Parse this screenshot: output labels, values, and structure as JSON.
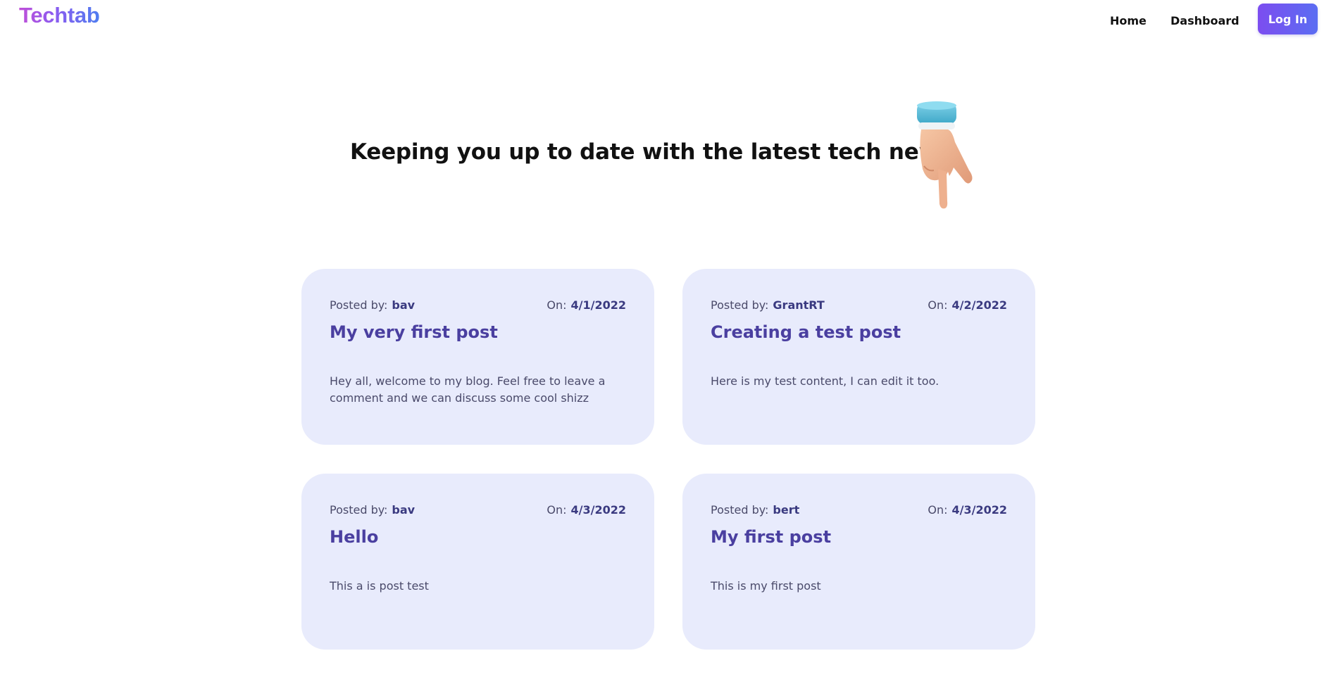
{
  "header": {
    "logo": "Techtab",
    "nav": {
      "home": "Home",
      "dashboard": "Dashboard"
    },
    "login_label": "Log In"
  },
  "hero": {
    "title": "Keeping you up to date with the latest tech news",
    "illustration": "pointing-hand-icon"
  },
  "colors": {
    "accent": "#6b5ff0",
    "card_background": "#e8ebfc",
    "title_color": "#4a3fa0"
  },
  "posts": [
    {
      "posted_by_label": "Posted by:",
      "author": "bav",
      "on_label": "On:",
      "date": "4/1/2022",
      "title": "My very first post",
      "content": "Hey all, welcome to my blog. Feel free to leave a comment and we can discuss some cool shizz"
    },
    {
      "posted_by_label": "Posted by:",
      "author": "GrantRT",
      "on_label": "On:",
      "date": "4/2/2022",
      "title": "Creating a test post",
      "content": "Here is my test content, I can edit it too."
    },
    {
      "posted_by_label": "Posted by:",
      "author": "bav",
      "on_label": "On:",
      "date": "4/3/2022",
      "title": "Hello",
      "content": "This a is post test"
    },
    {
      "posted_by_label": "Posted by:",
      "author": "bert",
      "on_label": "On:",
      "date": "4/3/2022",
      "title": "My first post",
      "content": "This is my first post"
    }
  ]
}
